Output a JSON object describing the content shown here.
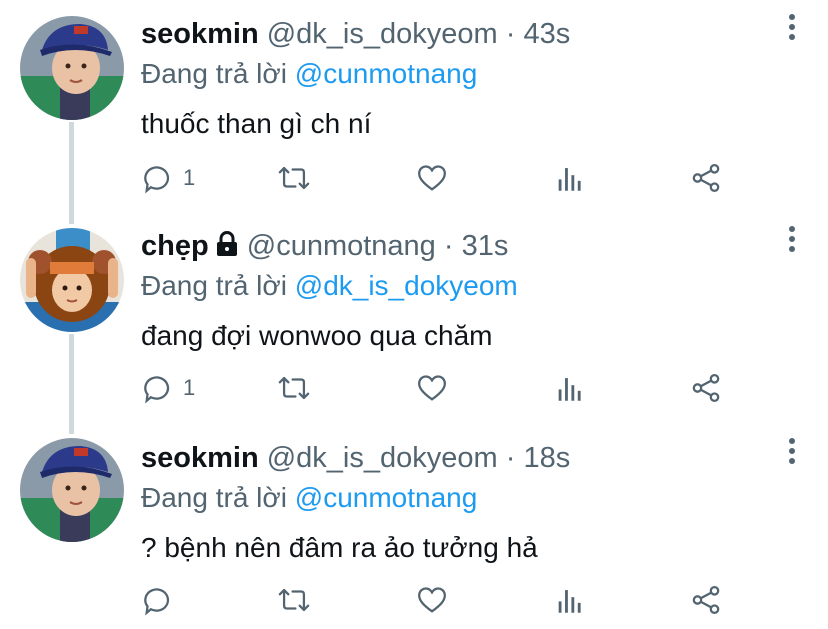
{
  "replies": [
    {
      "display_name": "seokmin",
      "handle": "@dk_is_dokyeom",
      "separator": "·",
      "time": "43s",
      "replying_label": "Đang trả lời",
      "replying_to": "@cunmotnang",
      "text": "thuốc than gì ch ní",
      "reply_count": "1",
      "protected": false,
      "avatar": "avatar-seokmin-blue-cap"
    },
    {
      "display_name": "chẹp",
      "handle": "@cunmotnang",
      "separator": "·",
      "time": "31s",
      "replying_label": "Đang trả lời",
      "replying_to": "@dk_is_dokyeom",
      "text": "đang đợi wonwoo qua chăm",
      "reply_count": "1",
      "protected": true,
      "avatar": "avatar-child-lion-costume"
    },
    {
      "display_name": "seokmin",
      "handle": "@dk_is_dokyeom",
      "separator": "·",
      "time": "18s",
      "replying_label": "Đang trả lời",
      "replying_to": "@cunmotnang",
      "text": "? bệnh nên đâm ra ảo tưởng hả",
      "reply_count": "",
      "protected": false,
      "avatar": "avatar-seokmin-blue-cap"
    }
  ],
  "icons": [
    "reply-icon",
    "retweet-icon",
    "like-icon",
    "analytics-icon",
    "share-icon",
    "more-icon",
    "lock-icon"
  ],
  "colors": {
    "text": "#0f1419",
    "secondary": "#536471",
    "link": "#1d9bf0",
    "thread_line": "#cfd9de"
  }
}
